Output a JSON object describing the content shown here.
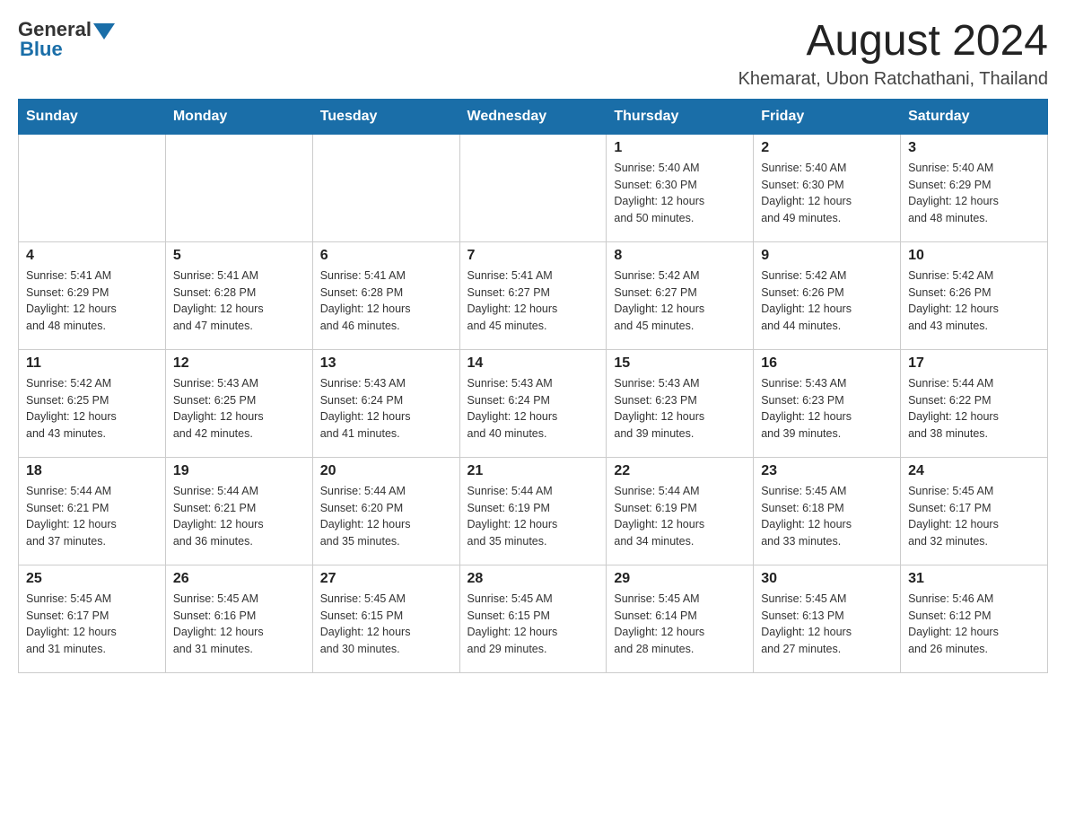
{
  "logo": {
    "text_general": "General",
    "text_blue": "Blue"
  },
  "title": "August 2024",
  "subtitle": "Khemarat, Ubon Ratchathani, Thailand",
  "days_of_week": [
    "Sunday",
    "Monday",
    "Tuesday",
    "Wednesday",
    "Thursday",
    "Friday",
    "Saturday"
  ],
  "weeks": [
    [
      {
        "day": "",
        "info": ""
      },
      {
        "day": "",
        "info": ""
      },
      {
        "day": "",
        "info": ""
      },
      {
        "day": "",
        "info": ""
      },
      {
        "day": "1",
        "info": "Sunrise: 5:40 AM\nSunset: 6:30 PM\nDaylight: 12 hours\nand 50 minutes."
      },
      {
        "day": "2",
        "info": "Sunrise: 5:40 AM\nSunset: 6:30 PM\nDaylight: 12 hours\nand 49 minutes."
      },
      {
        "day": "3",
        "info": "Sunrise: 5:40 AM\nSunset: 6:29 PM\nDaylight: 12 hours\nand 48 minutes."
      }
    ],
    [
      {
        "day": "4",
        "info": "Sunrise: 5:41 AM\nSunset: 6:29 PM\nDaylight: 12 hours\nand 48 minutes."
      },
      {
        "day": "5",
        "info": "Sunrise: 5:41 AM\nSunset: 6:28 PM\nDaylight: 12 hours\nand 47 minutes."
      },
      {
        "day": "6",
        "info": "Sunrise: 5:41 AM\nSunset: 6:28 PM\nDaylight: 12 hours\nand 46 minutes."
      },
      {
        "day": "7",
        "info": "Sunrise: 5:41 AM\nSunset: 6:27 PM\nDaylight: 12 hours\nand 45 minutes."
      },
      {
        "day": "8",
        "info": "Sunrise: 5:42 AM\nSunset: 6:27 PM\nDaylight: 12 hours\nand 45 minutes."
      },
      {
        "day": "9",
        "info": "Sunrise: 5:42 AM\nSunset: 6:26 PM\nDaylight: 12 hours\nand 44 minutes."
      },
      {
        "day": "10",
        "info": "Sunrise: 5:42 AM\nSunset: 6:26 PM\nDaylight: 12 hours\nand 43 minutes."
      }
    ],
    [
      {
        "day": "11",
        "info": "Sunrise: 5:42 AM\nSunset: 6:25 PM\nDaylight: 12 hours\nand 43 minutes."
      },
      {
        "day": "12",
        "info": "Sunrise: 5:43 AM\nSunset: 6:25 PM\nDaylight: 12 hours\nand 42 minutes."
      },
      {
        "day": "13",
        "info": "Sunrise: 5:43 AM\nSunset: 6:24 PM\nDaylight: 12 hours\nand 41 minutes."
      },
      {
        "day": "14",
        "info": "Sunrise: 5:43 AM\nSunset: 6:24 PM\nDaylight: 12 hours\nand 40 minutes."
      },
      {
        "day": "15",
        "info": "Sunrise: 5:43 AM\nSunset: 6:23 PM\nDaylight: 12 hours\nand 39 minutes."
      },
      {
        "day": "16",
        "info": "Sunrise: 5:43 AM\nSunset: 6:23 PM\nDaylight: 12 hours\nand 39 minutes."
      },
      {
        "day": "17",
        "info": "Sunrise: 5:44 AM\nSunset: 6:22 PM\nDaylight: 12 hours\nand 38 minutes."
      }
    ],
    [
      {
        "day": "18",
        "info": "Sunrise: 5:44 AM\nSunset: 6:21 PM\nDaylight: 12 hours\nand 37 minutes."
      },
      {
        "day": "19",
        "info": "Sunrise: 5:44 AM\nSunset: 6:21 PM\nDaylight: 12 hours\nand 36 minutes."
      },
      {
        "day": "20",
        "info": "Sunrise: 5:44 AM\nSunset: 6:20 PM\nDaylight: 12 hours\nand 35 minutes."
      },
      {
        "day": "21",
        "info": "Sunrise: 5:44 AM\nSunset: 6:19 PM\nDaylight: 12 hours\nand 35 minutes."
      },
      {
        "day": "22",
        "info": "Sunrise: 5:44 AM\nSunset: 6:19 PM\nDaylight: 12 hours\nand 34 minutes."
      },
      {
        "day": "23",
        "info": "Sunrise: 5:45 AM\nSunset: 6:18 PM\nDaylight: 12 hours\nand 33 minutes."
      },
      {
        "day": "24",
        "info": "Sunrise: 5:45 AM\nSunset: 6:17 PM\nDaylight: 12 hours\nand 32 minutes."
      }
    ],
    [
      {
        "day": "25",
        "info": "Sunrise: 5:45 AM\nSunset: 6:17 PM\nDaylight: 12 hours\nand 31 minutes."
      },
      {
        "day": "26",
        "info": "Sunrise: 5:45 AM\nSunset: 6:16 PM\nDaylight: 12 hours\nand 31 minutes."
      },
      {
        "day": "27",
        "info": "Sunrise: 5:45 AM\nSunset: 6:15 PM\nDaylight: 12 hours\nand 30 minutes."
      },
      {
        "day": "28",
        "info": "Sunrise: 5:45 AM\nSunset: 6:15 PM\nDaylight: 12 hours\nand 29 minutes."
      },
      {
        "day": "29",
        "info": "Sunrise: 5:45 AM\nSunset: 6:14 PM\nDaylight: 12 hours\nand 28 minutes."
      },
      {
        "day": "30",
        "info": "Sunrise: 5:45 AM\nSunset: 6:13 PM\nDaylight: 12 hours\nand 27 minutes."
      },
      {
        "day": "31",
        "info": "Sunrise: 5:46 AM\nSunset: 6:12 PM\nDaylight: 12 hours\nand 26 minutes."
      }
    ]
  ]
}
